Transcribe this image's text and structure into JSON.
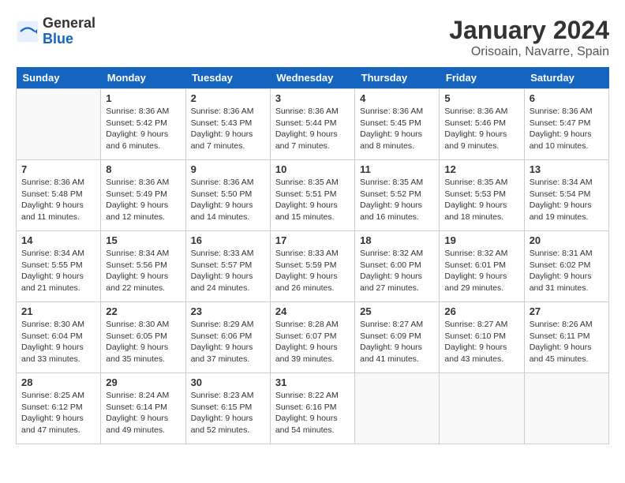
{
  "logo": {
    "general": "General",
    "blue": "Blue"
  },
  "title": "January 2024",
  "subtitle": "Orisoain, Navarre, Spain",
  "headers": [
    "Sunday",
    "Monday",
    "Tuesday",
    "Wednesday",
    "Thursday",
    "Friday",
    "Saturday"
  ],
  "weeks": [
    [
      {
        "day": "",
        "info": ""
      },
      {
        "day": "1",
        "info": "Sunrise: 8:36 AM\nSunset: 5:42 PM\nDaylight: 9 hours\nand 6 minutes."
      },
      {
        "day": "2",
        "info": "Sunrise: 8:36 AM\nSunset: 5:43 PM\nDaylight: 9 hours\nand 7 minutes."
      },
      {
        "day": "3",
        "info": "Sunrise: 8:36 AM\nSunset: 5:44 PM\nDaylight: 9 hours\nand 7 minutes."
      },
      {
        "day": "4",
        "info": "Sunrise: 8:36 AM\nSunset: 5:45 PM\nDaylight: 9 hours\nand 8 minutes."
      },
      {
        "day": "5",
        "info": "Sunrise: 8:36 AM\nSunset: 5:46 PM\nDaylight: 9 hours\nand 9 minutes."
      },
      {
        "day": "6",
        "info": "Sunrise: 8:36 AM\nSunset: 5:47 PM\nDaylight: 9 hours\nand 10 minutes."
      }
    ],
    [
      {
        "day": "7",
        "info": "Sunrise: 8:36 AM\nSunset: 5:48 PM\nDaylight: 9 hours\nand 11 minutes."
      },
      {
        "day": "8",
        "info": "Sunrise: 8:36 AM\nSunset: 5:49 PM\nDaylight: 9 hours\nand 12 minutes."
      },
      {
        "day": "9",
        "info": "Sunrise: 8:36 AM\nSunset: 5:50 PM\nDaylight: 9 hours\nand 14 minutes."
      },
      {
        "day": "10",
        "info": "Sunrise: 8:35 AM\nSunset: 5:51 PM\nDaylight: 9 hours\nand 15 minutes."
      },
      {
        "day": "11",
        "info": "Sunrise: 8:35 AM\nSunset: 5:52 PM\nDaylight: 9 hours\nand 16 minutes."
      },
      {
        "day": "12",
        "info": "Sunrise: 8:35 AM\nSunset: 5:53 PM\nDaylight: 9 hours\nand 18 minutes."
      },
      {
        "day": "13",
        "info": "Sunrise: 8:34 AM\nSunset: 5:54 PM\nDaylight: 9 hours\nand 19 minutes."
      }
    ],
    [
      {
        "day": "14",
        "info": "Sunrise: 8:34 AM\nSunset: 5:55 PM\nDaylight: 9 hours\nand 21 minutes."
      },
      {
        "day": "15",
        "info": "Sunrise: 8:34 AM\nSunset: 5:56 PM\nDaylight: 9 hours\nand 22 minutes."
      },
      {
        "day": "16",
        "info": "Sunrise: 8:33 AM\nSunset: 5:57 PM\nDaylight: 9 hours\nand 24 minutes."
      },
      {
        "day": "17",
        "info": "Sunrise: 8:33 AM\nSunset: 5:59 PM\nDaylight: 9 hours\nand 26 minutes."
      },
      {
        "day": "18",
        "info": "Sunrise: 8:32 AM\nSunset: 6:00 PM\nDaylight: 9 hours\nand 27 minutes."
      },
      {
        "day": "19",
        "info": "Sunrise: 8:32 AM\nSunset: 6:01 PM\nDaylight: 9 hours\nand 29 minutes."
      },
      {
        "day": "20",
        "info": "Sunrise: 8:31 AM\nSunset: 6:02 PM\nDaylight: 9 hours\nand 31 minutes."
      }
    ],
    [
      {
        "day": "21",
        "info": "Sunrise: 8:30 AM\nSunset: 6:04 PM\nDaylight: 9 hours\nand 33 minutes."
      },
      {
        "day": "22",
        "info": "Sunrise: 8:30 AM\nSunset: 6:05 PM\nDaylight: 9 hours\nand 35 minutes."
      },
      {
        "day": "23",
        "info": "Sunrise: 8:29 AM\nSunset: 6:06 PM\nDaylight: 9 hours\nand 37 minutes."
      },
      {
        "day": "24",
        "info": "Sunrise: 8:28 AM\nSunset: 6:07 PM\nDaylight: 9 hours\nand 39 minutes."
      },
      {
        "day": "25",
        "info": "Sunrise: 8:27 AM\nSunset: 6:09 PM\nDaylight: 9 hours\nand 41 minutes."
      },
      {
        "day": "26",
        "info": "Sunrise: 8:27 AM\nSunset: 6:10 PM\nDaylight: 9 hours\nand 43 minutes."
      },
      {
        "day": "27",
        "info": "Sunrise: 8:26 AM\nSunset: 6:11 PM\nDaylight: 9 hours\nand 45 minutes."
      }
    ],
    [
      {
        "day": "28",
        "info": "Sunrise: 8:25 AM\nSunset: 6:12 PM\nDaylight: 9 hours\nand 47 minutes."
      },
      {
        "day": "29",
        "info": "Sunrise: 8:24 AM\nSunset: 6:14 PM\nDaylight: 9 hours\nand 49 minutes."
      },
      {
        "day": "30",
        "info": "Sunrise: 8:23 AM\nSunset: 6:15 PM\nDaylight: 9 hours\nand 52 minutes."
      },
      {
        "day": "31",
        "info": "Sunrise: 8:22 AM\nSunset: 6:16 PM\nDaylight: 9 hours\nand 54 minutes."
      },
      {
        "day": "",
        "info": ""
      },
      {
        "day": "",
        "info": ""
      },
      {
        "day": "",
        "info": ""
      }
    ]
  ]
}
